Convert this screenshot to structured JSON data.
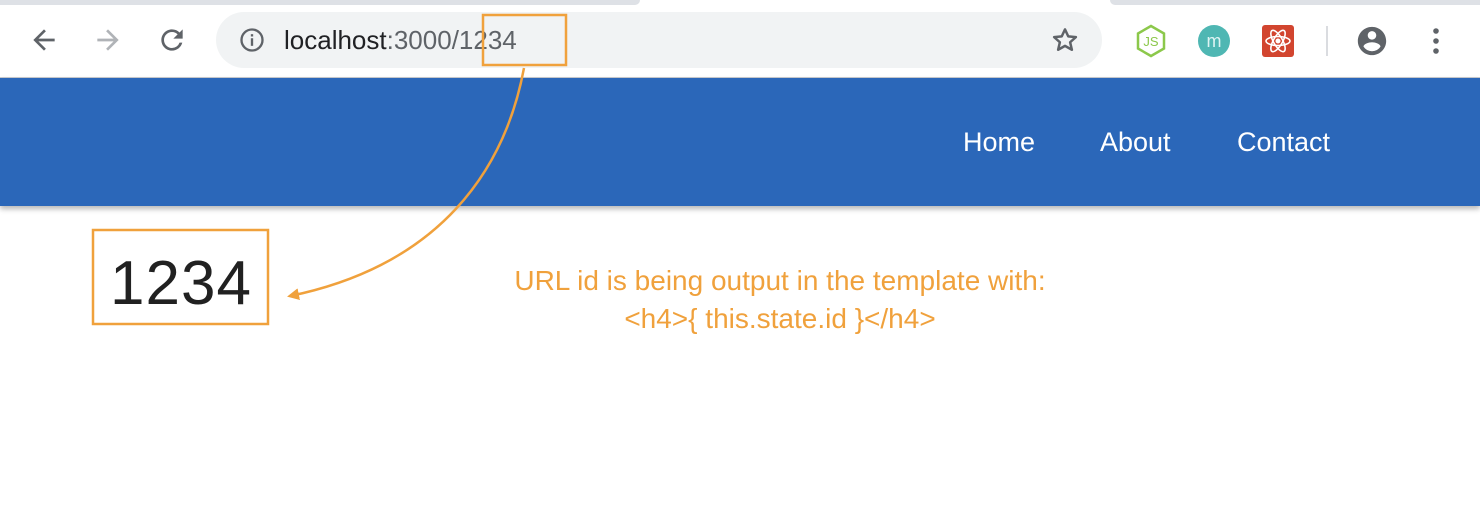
{
  "browser": {
    "url_host": "localhost",
    "url_port_path": ":3000/",
    "url_id": "1234",
    "icons": {
      "back": "arrow-left-icon",
      "forward": "arrow-right-icon",
      "reload": "reload-icon",
      "site_info": "info-circle-icon",
      "bookmark": "star-icon",
      "profile": "account-circle-icon",
      "menu": "kebab-menu-icon"
    },
    "extensions": [
      {
        "name": "nodejs-extension-icon",
        "label": "JS",
        "color": "#8cc84b"
      },
      {
        "name": "m-extension-icon",
        "label": "m",
        "color": "#4fb7b3"
      },
      {
        "name": "react-devtools-extension-icon",
        "color": "#d2452f"
      }
    ]
  },
  "navbar": {
    "color": "#2b67b9",
    "links": [
      "Home",
      "About",
      "Contact"
    ]
  },
  "page": {
    "id_text": "1234"
  },
  "annotation": {
    "color": "#f0a13c",
    "line1": "URL id is being output in the template with:",
    "line2": "<h4>{ this.state.id }</h4>"
  }
}
